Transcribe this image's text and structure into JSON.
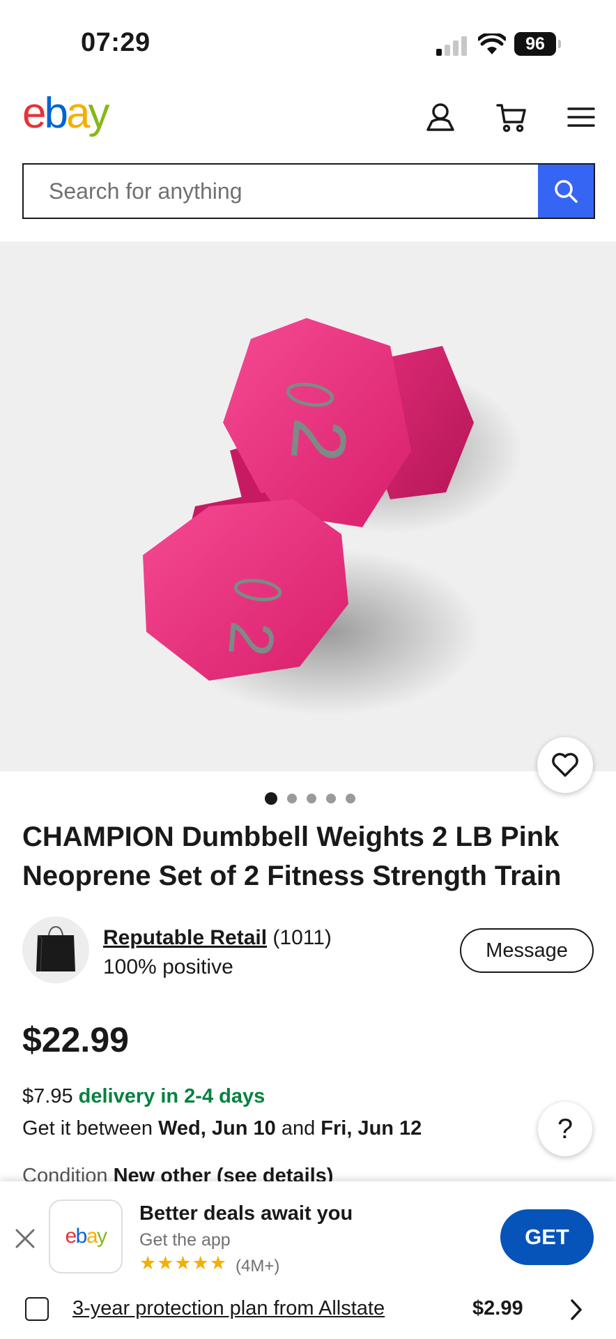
{
  "status_bar": {
    "time": "07:29",
    "battery": "96"
  },
  "header": {
    "logo": {
      "e": "e",
      "b": "b",
      "a": "a",
      "y": "y"
    },
    "icons": [
      "user-icon",
      "cart-icon",
      "menu-icon"
    ]
  },
  "search": {
    "placeholder": "Search for anything"
  },
  "gallery": {
    "image_count": 5,
    "active_index": 0
  },
  "product": {
    "title": "CHAMPION Dumbbell Weights 2 LB Pink Neoprene Set of 2 Fitness Strength Train",
    "price": "$22.99"
  },
  "seller": {
    "name": "Reputable Retail",
    "count": "(1011)",
    "feedback": "100% positive",
    "message_label": "Message"
  },
  "shipping": {
    "cost": "$7.95",
    "speed": "delivery in 2-4 days",
    "between_prefix": "Get it between",
    "date_start": "Wed, Jun 10",
    "and": "and",
    "date_end": "Fri, Jun 12"
  },
  "condition": {
    "label": "Condition",
    "value": "New other (see details)"
  },
  "help_label": "?",
  "app_banner": {
    "tile_logo": {
      "e": "e",
      "b": "b",
      "a": "a",
      "y": "y"
    },
    "title": "Better deals await you",
    "subtitle": "Get the app",
    "stars": "★★★★★",
    "rating_count": "(4M+)",
    "get_label": "GET"
  },
  "protection": {
    "label": "3-year protection plan from Allstate",
    "price": "$2.99"
  },
  "colors": {
    "ebay_red": "#e53238",
    "ebay_blue": "#0064d2",
    "ebay_yellow": "#f5af02",
    "ebay_green": "#86b817",
    "search_blue": "#3665f3",
    "get_blue": "#0654ba",
    "delivery_green": "#05823f",
    "product_pink": "#f0287a"
  }
}
